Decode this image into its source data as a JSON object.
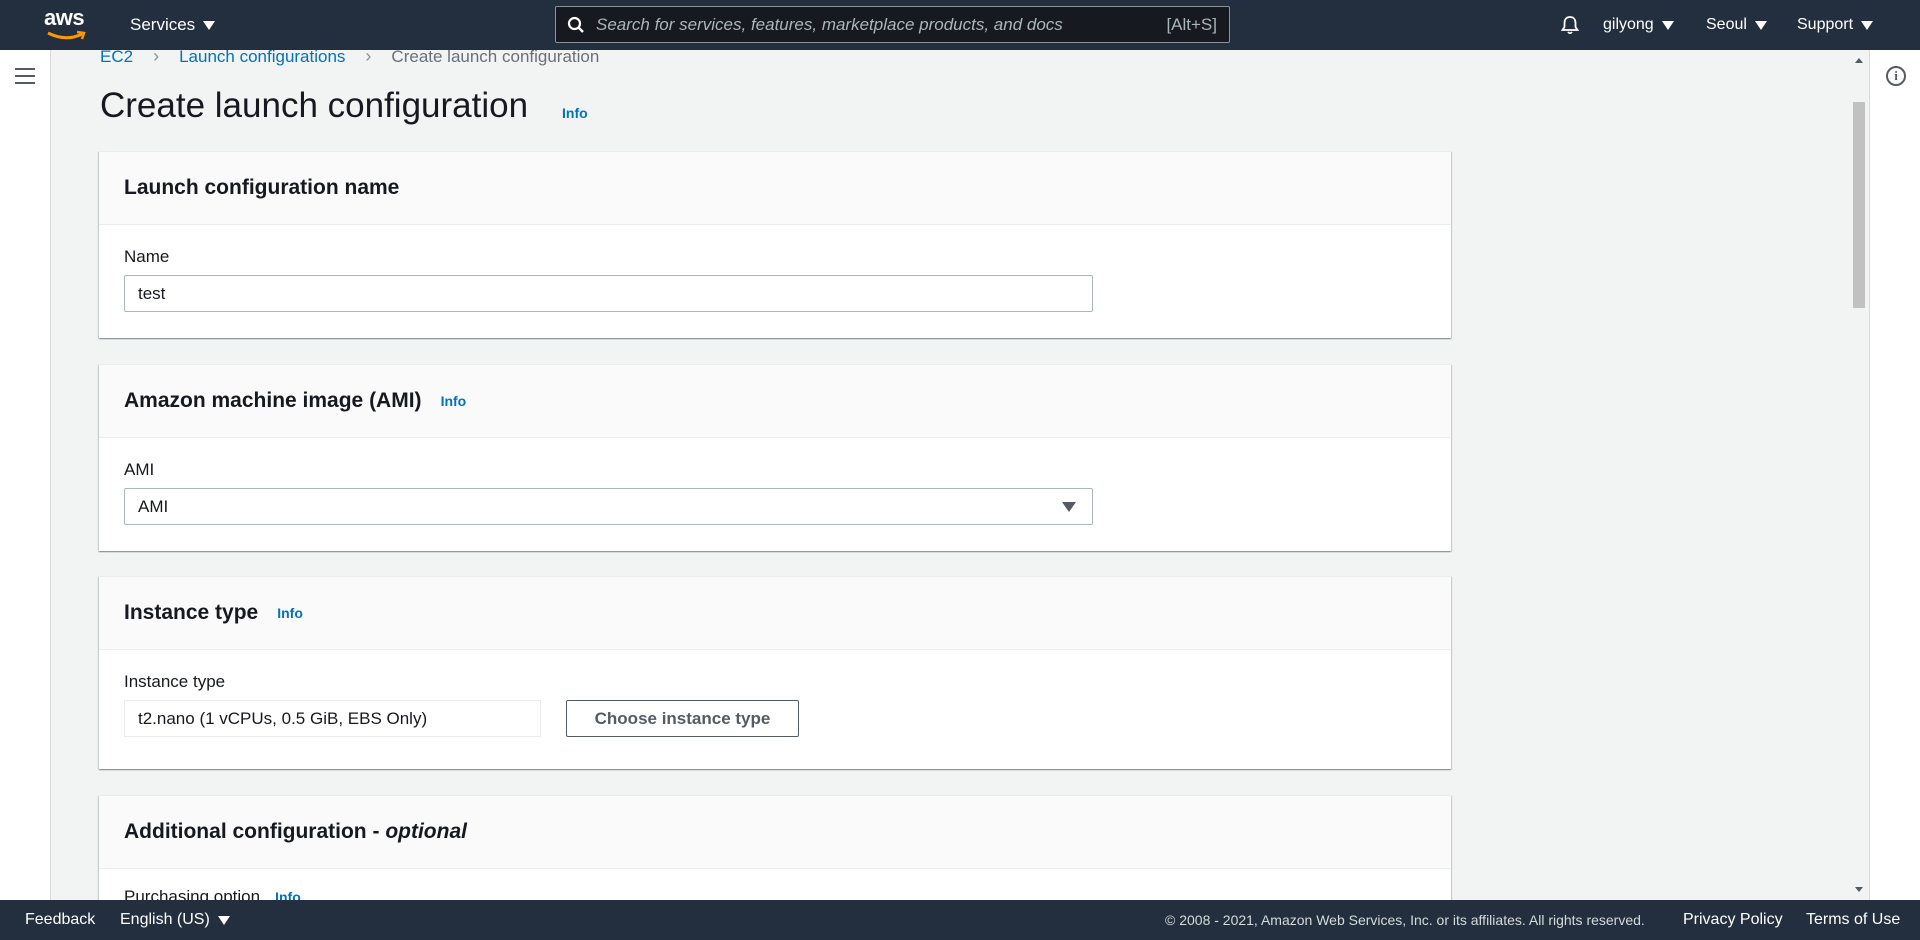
{
  "topnav": {
    "logo_text": "aws",
    "services_label": "Services",
    "search_placeholder": "Search for services, features, marketplace products, and docs",
    "search_shortcut": "[Alt+S]",
    "user": "gilyong",
    "region": "Seoul",
    "support": "Support"
  },
  "breadcrumb": {
    "items": [
      "EC2",
      "Launch configurations"
    ],
    "current": "Create launch configuration"
  },
  "page": {
    "title": "Create launch configuration",
    "info": "Info"
  },
  "sections": {
    "name": {
      "title": "Launch configuration name",
      "field_label": "Name",
      "value": "test"
    },
    "ami": {
      "title": "Amazon machine image (AMI)",
      "info": "Info",
      "field_label": "AMI",
      "value": "AMI"
    },
    "instance": {
      "title": "Instance type",
      "info": "Info",
      "field_label": "Instance type",
      "value": "t2.nano (1 vCPUs, 0.5 GiB, EBS Only)",
      "button": "Choose instance type"
    },
    "additional": {
      "title": "Additional configuration - ",
      "title_optional": "optional",
      "partial_label": "Purchasing option",
      "partial_info": "Info"
    }
  },
  "footer": {
    "feedback": "Feedback",
    "language": "English (US)",
    "copyright": "© 2008 - 2021, Amazon Web Services, Inc. or its affiliates. All rights reserved.",
    "privacy": "Privacy Policy",
    "terms": "Terms of Use"
  },
  "colors": {
    "nav_bg": "#232f3e",
    "link": "#0073bb",
    "page_bg": "#f2f3f3",
    "logo_smile": "#ff9900"
  }
}
